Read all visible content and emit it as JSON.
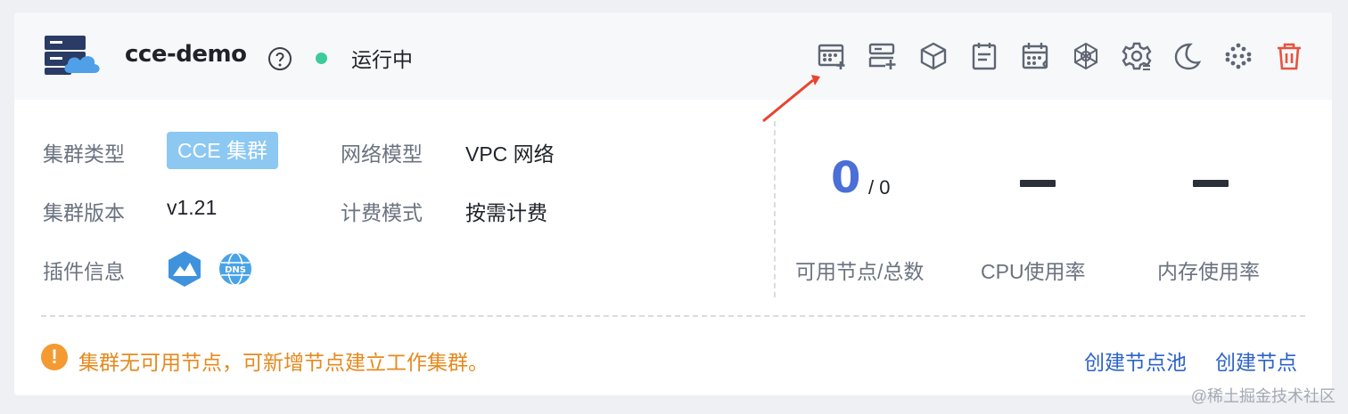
{
  "header": {
    "cluster_name": "cce-demo",
    "status_text": "运行中",
    "status_color": "#3ecb9a",
    "toolbar_icons": [
      "add-grid-icon",
      "add-server-icon",
      "cube-icon",
      "document-icon",
      "calendar-grid-icon",
      "network-hex-icon",
      "settings-gear-icon",
      "moon-icon",
      "dots-cluster-icon",
      "trash-icon"
    ]
  },
  "info": {
    "type_label": "集群类型",
    "type_value": "CCE 集群",
    "network_label": "网络模型",
    "network_value": "VPC 网络",
    "version_label": "集群版本",
    "version_value": "v1.21",
    "billing_label": "计费模式",
    "billing_value": "按需计费",
    "addon_label": "插件信息",
    "addon_icons": [
      "mountain-hex-icon",
      "dns-globe-icon"
    ]
  },
  "metrics": {
    "available_nodes": "0",
    "total_nodes": "/ 0",
    "nodes_label": "可用节点/总数",
    "cpu_label": "CPU使用率",
    "memory_label": "内存使用率"
  },
  "footer": {
    "warning_text": "集群无可用节点，可新增节点建立工作集群。",
    "create_pool_link": "创建节点池",
    "create_node_link": "创建节点"
  },
  "watermark": "@稀土掘金技术社区",
  "colors": {
    "accent_blue": "#4a6fd6",
    "link_blue": "#2d63c8",
    "warning_orange": "#f39a32",
    "danger_red": "#e5533d",
    "tag_blue": "#8cc8f2"
  }
}
